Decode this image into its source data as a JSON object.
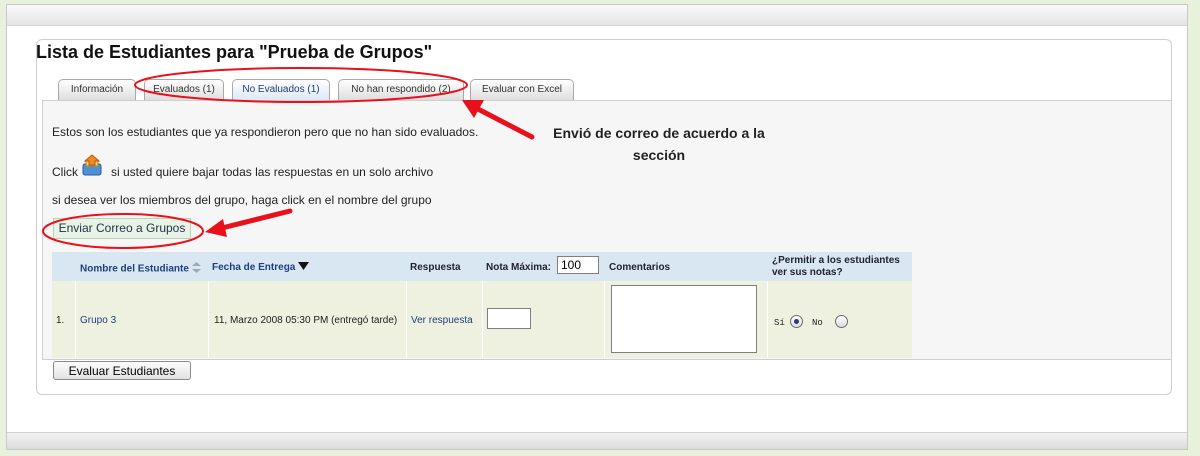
{
  "page": {
    "title": "Lista de Estudiantes para \"Prueba de Grupos\""
  },
  "tabs": [
    {
      "label": "Información",
      "active": false
    },
    {
      "label": "Evaluados (1)",
      "active": false
    },
    {
      "label": "No Evaluados (1)",
      "active": true
    },
    {
      "label": "No han respondido (2)",
      "active": false
    },
    {
      "label": "Evaluar con Excel",
      "active": false
    }
  ],
  "content": {
    "intro": "Estos son los estudiantes que ya respondieron pero que no han sido evaluados.",
    "click_word": "Click",
    "download_icon": "download-archive-icon",
    "click_rest": "si usted quiere bajar todas las respuestas en un solo archivo",
    "group_hint": "si desea ver los miembros del grupo, haga click en el nombre del grupo",
    "send_button": "Enviar Correo a Grupos"
  },
  "annotation": {
    "line1": "Envió de correo de acuerdo a la",
    "line2": "sección",
    "color": "#e8111b"
  },
  "table": {
    "headers": {
      "name": "Nombre del Estudiante",
      "name_sort_icon": "sort-both-icon",
      "date": "Fecha de Entrega",
      "date_sort_icon": "sort-down-icon",
      "response": "Respuesta",
      "max_grade": "Nota Máxima:",
      "max_grade_value": "100",
      "comments": "Comentarios",
      "permit": "¿Permitir a los estudiantes ver sus notas?"
    },
    "rows": [
      {
        "num": "1.",
        "name": "Grupo 3",
        "date": "11, Marzo 2008 05:30 PM (entregó tarde)",
        "response": "Ver respuesta",
        "grade": "",
        "comment": "",
        "permit_yes": "Sí",
        "permit_no": "No",
        "permit_value": "yes"
      }
    ]
  },
  "footer": {
    "evaluate_button": "Evaluar Estudiantes"
  },
  "colors": {
    "header_bg": "#d9e7f3",
    "row_bg": "#eef1df",
    "link": "#1f3f7a",
    "page_bg": "#e8f1dc"
  }
}
